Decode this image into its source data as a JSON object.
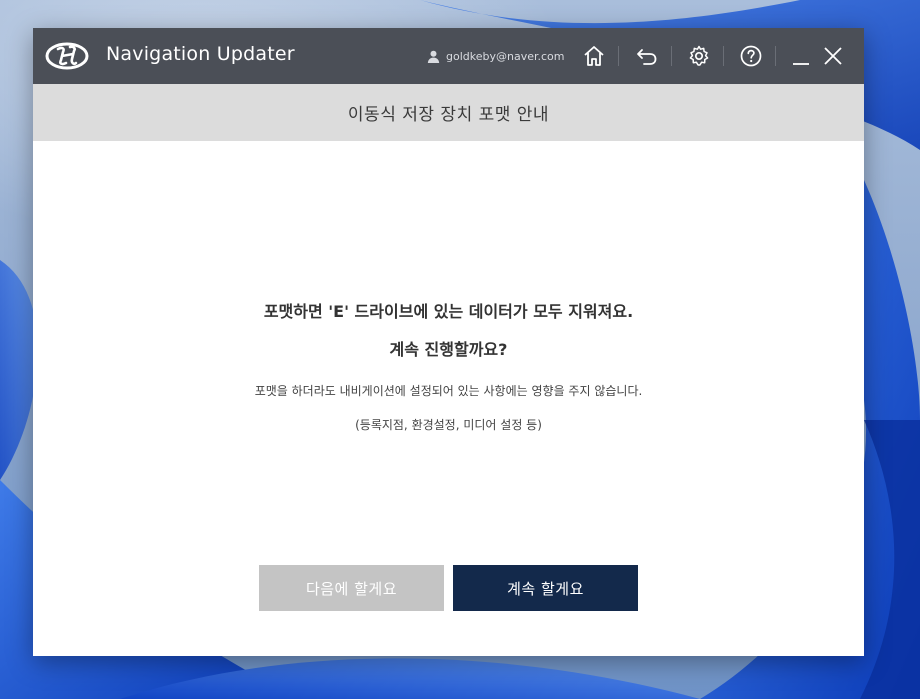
{
  "app": {
    "title": "Navigation Updater",
    "brand_logo": "hyundai-logo",
    "user_email": "goldkeby@naver.com"
  },
  "toolbar": {
    "icons": [
      "user-icon",
      "home-icon",
      "back-icon",
      "settings-icon",
      "help-icon",
      "minimize-icon",
      "close-icon"
    ]
  },
  "dialog": {
    "title": "이동식 저장 장치 포맷 안내",
    "message_line1": "포맷하면 'E' 드라이브에 있는 데이터가 모두 지워져요.",
    "message_line2": "계속 진행할까요?",
    "note_line1": "포맷을 하더라도 내비게이션에 설정되어 있는 사항에는 영향을 주지 않습니다.",
    "note_line2": "(등록지점, 환경설정, 미디어 설정 등)",
    "later_button": "다음에 할게요",
    "continue_button": "계속 할게요"
  },
  "colors": {
    "titlebar": "#4b4f57",
    "subheader": "#dcdcdc",
    "primary_button": "#13294b",
    "secondary_button": "#c4c4c4"
  }
}
